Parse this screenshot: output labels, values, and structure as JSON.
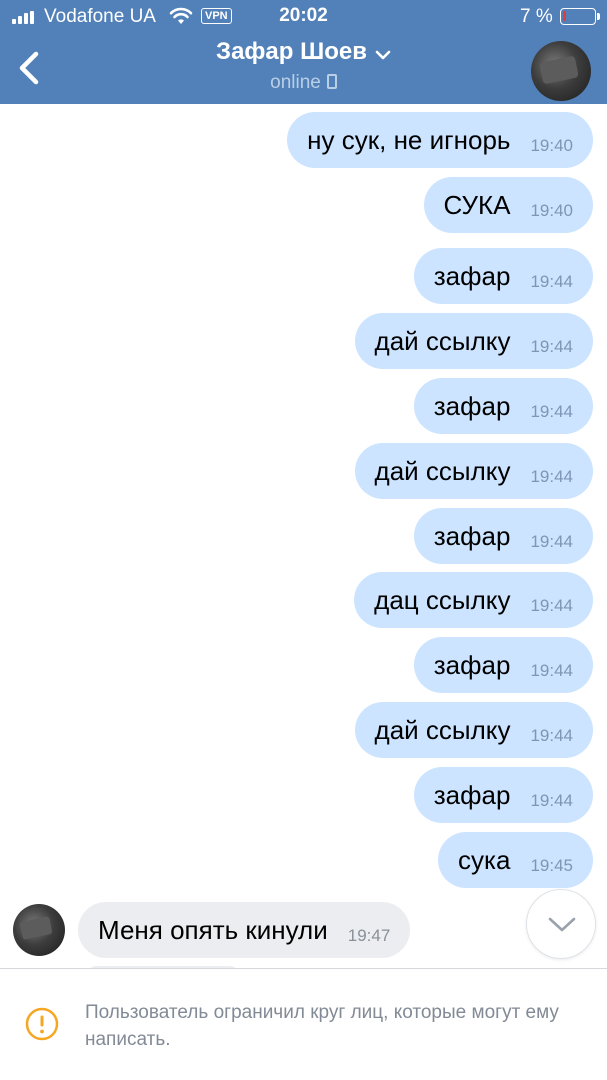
{
  "status_bar": {
    "carrier": "Vodafone UA",
    "vpn_label": "VPN",
    "time": "20:02",
    "battery_percent": "7 %"
  },
  "header": {
    "contact_name": "Зафар Шоев",
    "status": "online"
  },
  "messages": [
    {
      "direction": "out",
      "text": "ну сук, не игнорь",
      "time": "19:40"
    },
    {
      "direction": "out",
      "text": "СУКА",
      "time": "19:40"
    },
    {
      "direction": "out",
      "text": "зафар",
      "time": "19:44"
    },
    {
      "direction": "out",
      "text": "дай ссылку",
      "time": "19:44"
    },
    {
      "direction": "out",
      "text": "зафар",
      "time": "19:44"
    },
    {
      "direction": "out",
      "text": "дай ссылку",
      "time": "19:44"
    },
    {
      "direction": "out",
      "text": "зафар",
      "time": "19:44"
    },
    {
      "direction": "out",
      "text": "дац ссылку",
      "time": "19:44"
    },
    {
      "direction": "out",
      "text": "зафар",
      "time": "19:44"
    },
    {
      "direction": "out",
      "text": "дай ссылку",
      "time": "19:44"
    },
    {
      "direction": "out",
      "text": "зафар",
      "time": "19:44"
    },
    {
      "direction": "out",
      "text": "сука",
      "time": "19:45"
    },
    {
      "direction": "in",
      "text": "Меня опять кинули",
      "time": "19:47"
    }
  ],
  "footer": {
    "notice": "Пользователь ограничил круг лиц, которые могут ему написать."
  },
  "colors": {
    "header_bg": "#5181b8",
    "outgoing_bubble": "#cce4ff",
    "incoming_bubble": "#ebedf0",
    "warning": "#f5a623"
  }
}
